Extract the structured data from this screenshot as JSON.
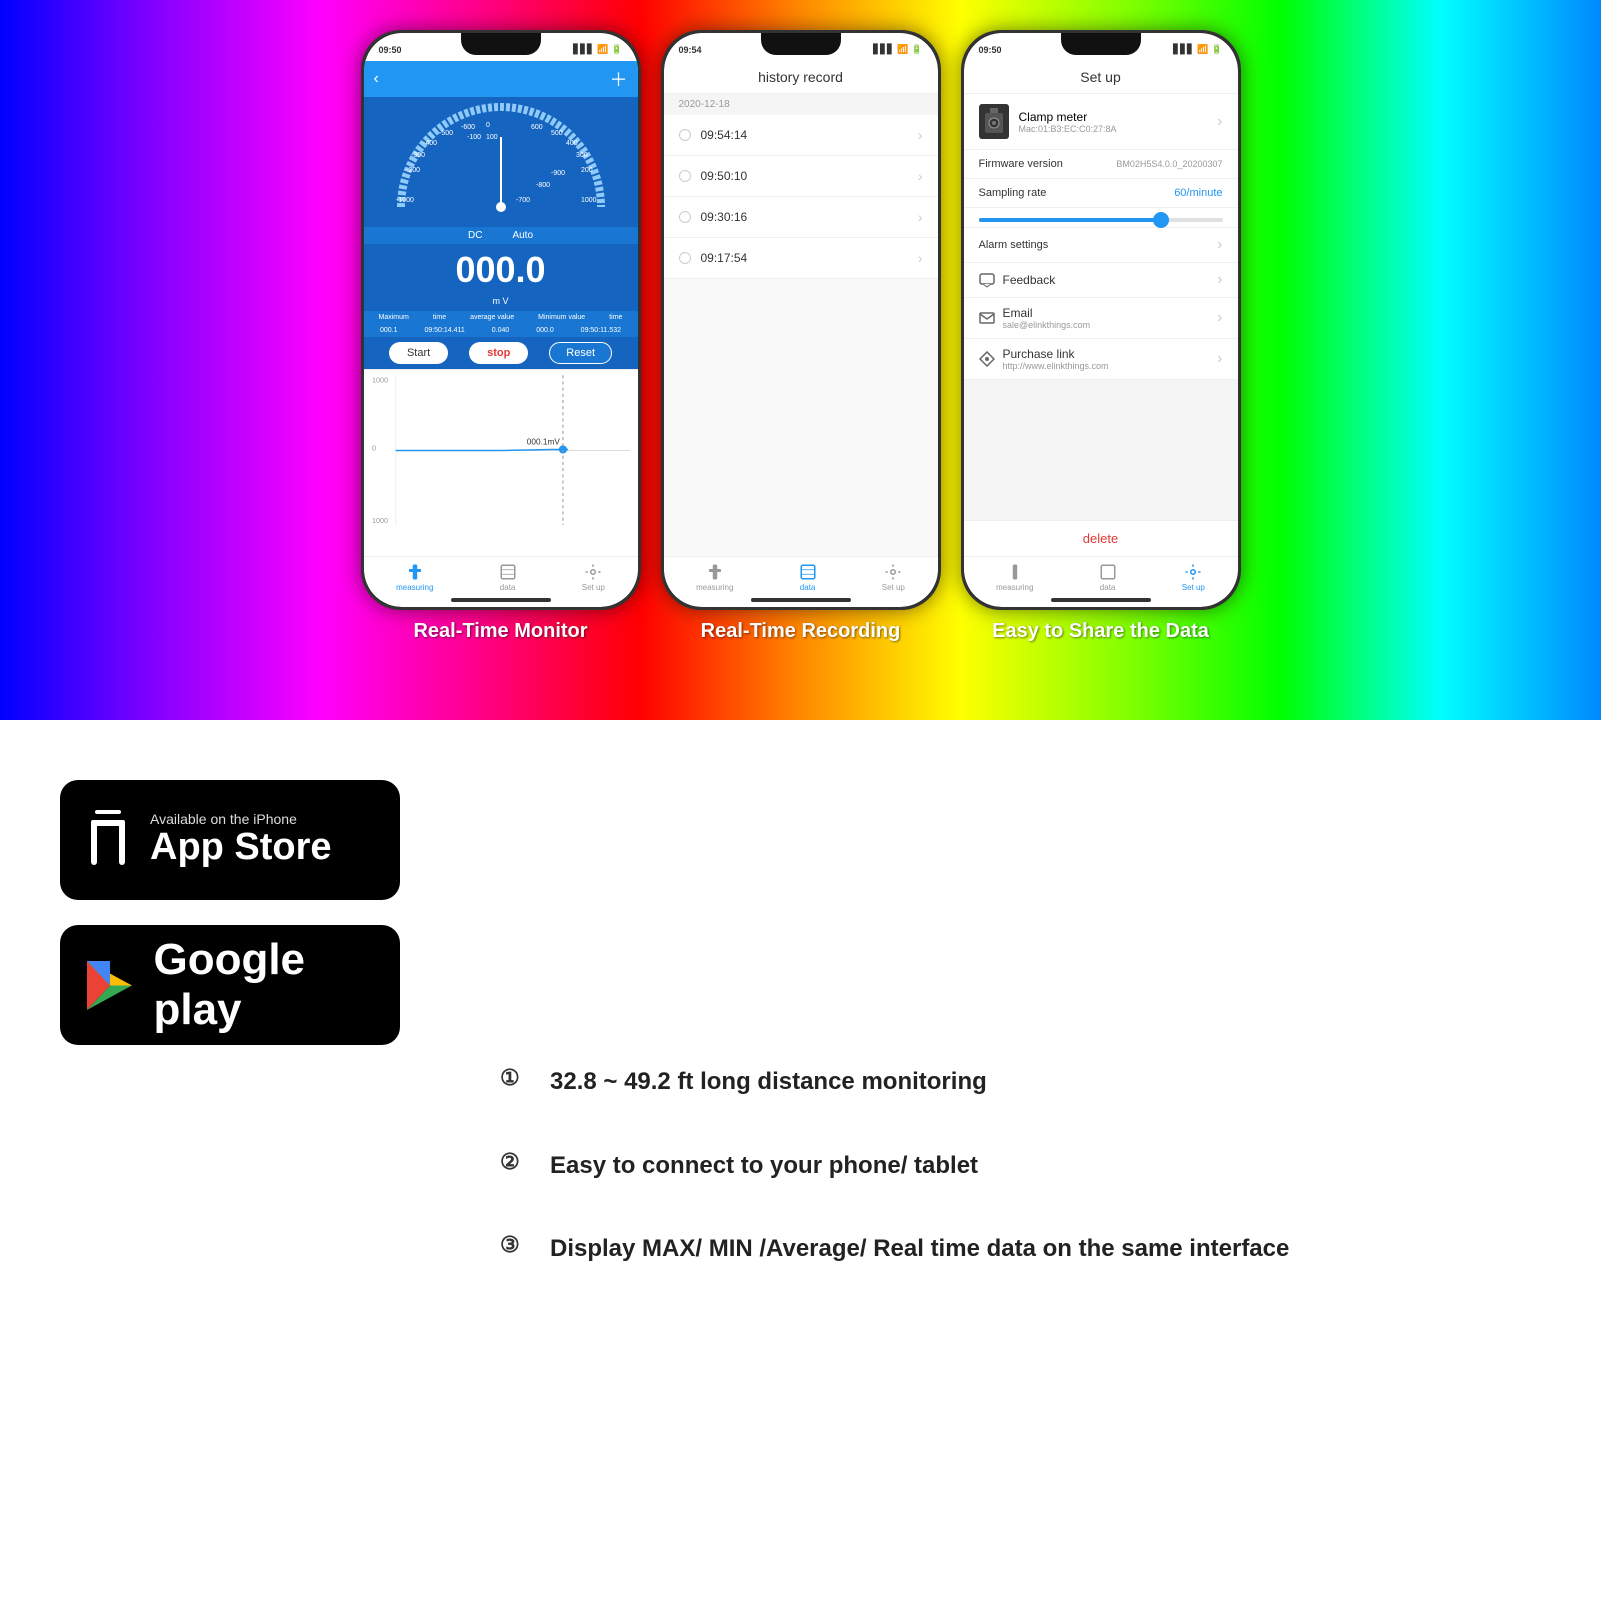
{
  "phones": [
    {
      "id": "phone1",
      "time": "09:50",
      "caption": "Real-Time Monitor",
      "screen": "monitor"
    },
    {
      "id": "phone2",
      "time": "09:54",
      "caption": "Real-Time Recording",
      "screen": "history"
    },
    {
      "id": "phone3",
      "time": "09:50",
      "caption": "Easy to Share the Data",
      "screen": "setup"
    }
  ],
  "phone1": {
    "dc_label": "DC",
    "auto_label": "Auto",
    "value": "000.0",
    "unit": "m V",
    "max_label": "Maximum",
    "max_val": "000.1",
    "avg_label": "average value",
    "avg_val": "0.040",
    "min_label": "Minimum value",
    "min_val": "000.0",
    "time_label": "time",
    "time_val": "09:50:11.532",
    "time2_val": "09:50:14.411",
    "btn_start": "Start",
    "btn_stop": "stop",
    "btn_reset": "Reset",
    "chart_label": "000.1mV",
    "nav_measuring": "measuring",
    "nav_data": "data",
    "nav_setup": "Set up"
  },
  "phone2": {
    "title": "history record",
    "date": "2020-12-18",
    "items": [
      "09:54:14",
      "09:50:10",
      "09:30:16",
      "09:17:54"
    ],
    "nav_measuring": "measuring",
    "nav_data": "data",
    "nav_setup": "Set up"
  },
  "phone3": {
    "title": "Set up",
    "device_name": "Clamp meter",
    "device_mac": "Mac:01:B3:EC:C0:27:8A",
    "firmware_label": "Firmware version",
    "firmware_val": "BM02H5S4.0.0_20200307",
    "sampling_label": "Sampling rate",
    "sampling_val": "60/minute",
    "alarm_label": "Alarm settings",
    "feedback_label": "Feedback",
    "email_label": "Email",
    "email_val": "sale@elinkthings.com",
    "purchase_label": "Purchase link",
    "purchase_val": "http://www.elinkthings.com",
    "delete_label": "delete",
    "nav_measuring": "measuring",
    "nav_data": "data",
    "nav_setup": "Set up"
  },
  "appstore": {
    "small_text": "Available on the iPhone",
    "big_text": "App Store"
  },
  "googleplay": {
    "text": "Google play"
  },
  "features": [
    {
      "number": "①",
      "text": "32.8 ~ 49.2 ft long distance monitoring"
    },
    {
      "number": "②",
      "text": "Easy to connect to your phone/ tablet"
    },
    {
      "number": "③",
      "text": "Display MAX/ MIN /Average/ Real time data on the same interface"
    }
  ]
}
